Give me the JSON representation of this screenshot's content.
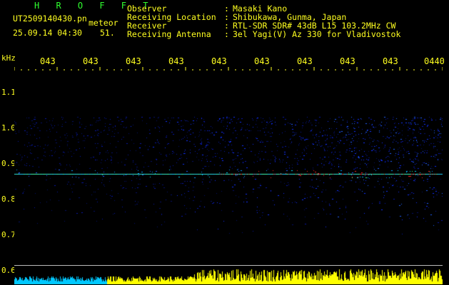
{
  "header": {
    "app_title": "H R O F F T",
    "file_name": "UT2509140430.pn",
    "meteor_label": "meteor",
    "date_time": "25.09.14 04:30",
    "count": "51.",
    "rows": [
      {
        "label": "Observer",
        "value": "Masaki Kano"
      },
      {
        "label": "Receiving Location",
        "value": "Shibukawa, Gunma, Japan"
      },
      {
        "label": "Receiver",
        "value": "RTL-SDR SDR# 43dB L15 103.2MHz CW"
      },
      {
        "label": "Receiving Antenna",
        "value": "3el Yagi(V) Az 330 for Vladivostok"
      }
    ]
  },
  "spectrogram": {
    "y_unit": "kHz",
    "y_ticks": [
      "1.1",
      "1.0",
      "0.9",
      "0.8",
      "0.7",
      "0.6"
    ],
    "x_ticks": [
      "043",
      "043",
      "043",
      "043",
      "043",
      "043",
      "043",
      "043",
      "043",
      "0440"
    ],
    "colors": {
      "text_yellow": "#ffff20",
      "title_green": "#30ff30",
      "echo_red": "#ff2020",
      "noise_blue": "#1030ff",
      "signal_yellow": "#ffff00",
      "signal_cyan": "#00c8ff"
    }
  }
}
